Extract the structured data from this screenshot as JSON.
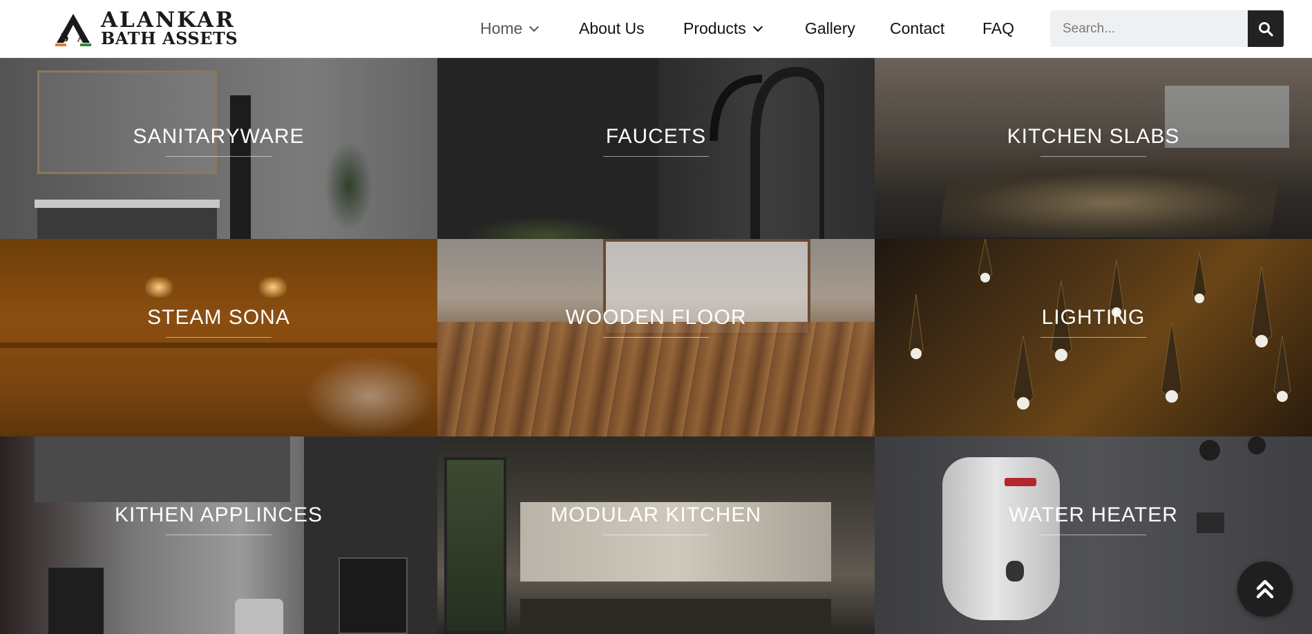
{
  "brand": {
    "line1": "ALANKAR",
    "line2": "BATH ASSETS",
    "mark_letters": "bIA",
    "colors": {
      "orange": "#e8782a",
      "green": "#2e8b3a",
      "dark": "#1a1a1a"
    }
  },
  "nav": {
    "items": [
      {
        "label": "Home",
        "has_dropdown": true,
        "active": true
      },
      {
        "label": "About Us",
        "has_dropdown": false
      },
      {
        "label": "Products",
        "has_dropdown": true
      },
      {
        "label": "Gallery",
        "has_dropdown": false
      },
      {
        "label": "Contact",
        "has_dropdown": false
      },
      {
        "label": "FAQ",
        "has_dropdown": false
      }
    ]
  },
  "search": {
    "placeholder": "Search...",
    "value": "",
    "button_icon": "search-icon"
  },
  "categories": [
    {
      "label": "SANITARYWARE"
    },
    {
      "label": "FAUCETS"
    },
    {
      "label": "KITCHEN SLABS"
    },
    {
      "label": "STEAM SONA"
    },
    {
      "label": "WOODEN FLOOR"
    },
    {
      "label": "LIGHTING"
    },
    {
      "label": "KITHEN APPLINCES"
    },
    {
      "label": "MODULAR KITCHEN"
    },
    {
      "label": "WATER HEATER"
    }
  ],
  "scroll_top": {
    "icon": "double-chevron-up-icon"
  }
}
